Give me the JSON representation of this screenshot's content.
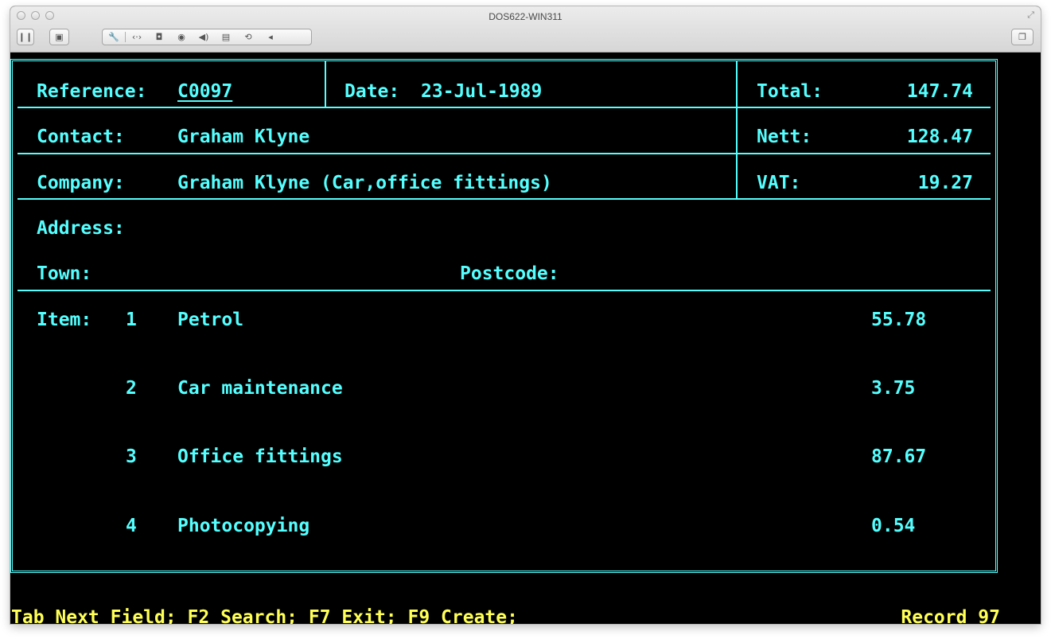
{
  "window": {
    "title": "DOS622-WIN311"
  },
  "toolbar": {
    "icons": [
      "pause-icon",
      "snapshot-icon",
      "settings-wrench-icon",
      "network-icon",
      "hard-disk-icon",
      "cd-rom-icon",
      "sound-icon",
      "floppy-icon",
      "usb-icon",
      "collapse-arrow-icon",
      "fullscreen-icon"
    ]
  },
  "form": {
    "reference_label": "Reference:",
    "reference_value": "C0097",
    "date_label": "Date:",
    "date_value": "23-Jul-1989",
    "total_label": "Total:",
    "total_value": "147.74",
    "contact_label": "Contact:",
    "contact_value": "Graham Klyne",
    "nett_label": "Nett:",
    "nett_value": "128.47",
    "company_label": "Company:",
    "company_value": "Graham Klyne (Car,office fittings)",
    "vat_label": "VAT:",
    "vat_value": "19.27",
    "address_label": "Address:",
    "town_label": "Town:",
    "postcode_label": "Postcode:",
    "item_label": "Item:",
    "items": [
      {
        "no": "1",
        "desc": "Petrol",
        "amount": "55.78"
      },
      {
        "no": "2",
        "desc": "Car maintenance",
        "amount": "3.75"
      },
      {
        "no": "3",
        "desc": "Office fittings",
        "amount": "87.67"
      },
      {
        "no": "4",
        "desc": "Photocopying",
        "amount": "0.54"
      }
    ]
  },
  "status": {
    "keys": "Tab Next Field; F2 Search; F7 Exit; F9 Create;",
    "record": "Record 97"
  },
  "colors": {
    "screen_bg": "#000000",
    "text_cyan": "#55ffff",
    "status_yellow": "#ffff55"
  }
}
